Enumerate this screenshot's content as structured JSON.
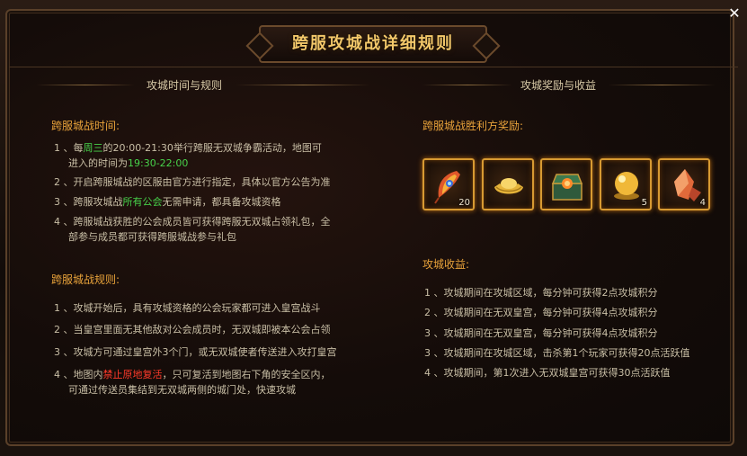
{
  "window": {
    "title": "跨服攻城战详细规则",
    "close_glyph": "✕"
  },
  "left": {
    "header": "攻城时间与规则",
    "time": {
      "heading": "跨服城战时间:",
      "items": [
        {
          "pre": "1 、每",
          "hl1": "周三",
          "mid": "的20:00-21:30举行跨服无双城争霸活动，地图可",
          "line2pre": "进入的时间为",
          "hl2": "19:30-22:00"
        },
        {
          "text": "2 、开启跨服城战的区服由官方进行指定，具体以官方公告为准"
        },
        {
          "pre": "3 、跨服攻城战",
          "hl": "所有公会",
          "post": "无需申请，都具备攻城资格"
        },
        {
          "text": "4 、跨服城战获胜的公会成员皆可获得跨服无双城占领礼包，全",
          "line2": "部参与成员都可获得跨服城战参与礼包"
        }
      ]
    },
    "rules": {
      "heading": "跨服城战规则:",
      "items": [
        {
          "text": "1 、攻城开始后，具有攻城资格的公会玩家都可进入皇宫战斗"
        },
        {
          "text": "2 、当皇宫里面无其他敌对公会成员时，无双城即被本公会占领"
        },
        {
          "text": "3 、攻城方可通过皇宫外3个门，或无双城使者传送进入攻打皇宫"
        },
        {
          "pre": "4 、地图内",
          "hl": "禁止原地复活",
          "post": "，只可复活到地图右下角的安全区内，",
          "line2": "可通过传送员集结到无双城两侧的城门处，快速攻城"
        }
      ]
    }
  },
  "right": {
    "header": "攻城奖励与收益",
    "rewards": {
      "heading": "跨服城战胜利方奖励:",
      "items": [
        {
          "icon": "phoenix-feather-icon",
          "count": "20"
        },
        {
          "icon": "gold-ingot-icon",
          "count": ""
        },
        {
          "icon": "treasure-chest-icon",
          "count": ""
        },
        {
          "icon": "golden-orb-icon",
          "count": "5"
        },
        {
          "icon": "crystal-ore-icon",
          "count": "4"
        }
      ]
    },
    "income": {
      "heading": "攻城收益:",
      "items": [
        "1 、攻城期间在攻城区域，每分钟可获得2点攻城积分",
        "2 、攻城期间在无双皇宫，每分钟可获得4点攻城积分",
        "3 、攻城期间在无双皇宫，每分钟可获得4点攻城积分",
        "3 、攻城期间在攻城区域，击杀第1个玩家可获得20点活跃值",
        "4 、攻城期间，第1次进入无双城皇宫可获得30点活跃值"
      ]
    }
  },
  "colors": {
    "accent": "#e8a23a",
    "title": "#f3c86a",
    "highlight_green": "#47d24a",
    "highlight_red": "#ff3a2a"
  }
}
